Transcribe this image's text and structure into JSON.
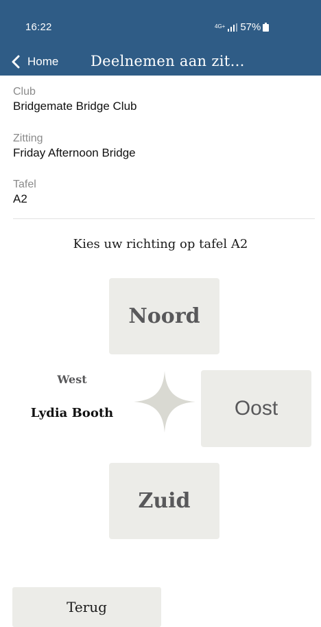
{
  "status_bar": {
    "time": "16:22",
    "network": "4G+",
    "battery": "57%",
    "icons": [
      "signal-icon",
      "battery-icon"
    ]
  },
  "app_bar": {
    "back_label": "Home",
    "title": "Deelnemen aan zit…",
    "back_icon": "chevron-left-icon",
    "background": "#2f5c86"
  },
  "info": {
    "club_label": "Club",
    "club_value": "Bridgemate Bridge Club",
    "session_label": "Zitting",
    "session_value": "Friday Afternoon Bridge",
    "table_label": "Tafel",
    "table_value": "A2"
  },
  "instruction": "Kies uw richting op tafel A2",
  "directions": {
    "north": "Noord",
    "east": "Oost",
    "south": "Zuid",
    "west_label": "West",
    "west_player": "Lydia Booth"
  },
  "compass_icon": "compass-star-icon",
  "footer": {
    "back_button": "Terug"
  }
}
